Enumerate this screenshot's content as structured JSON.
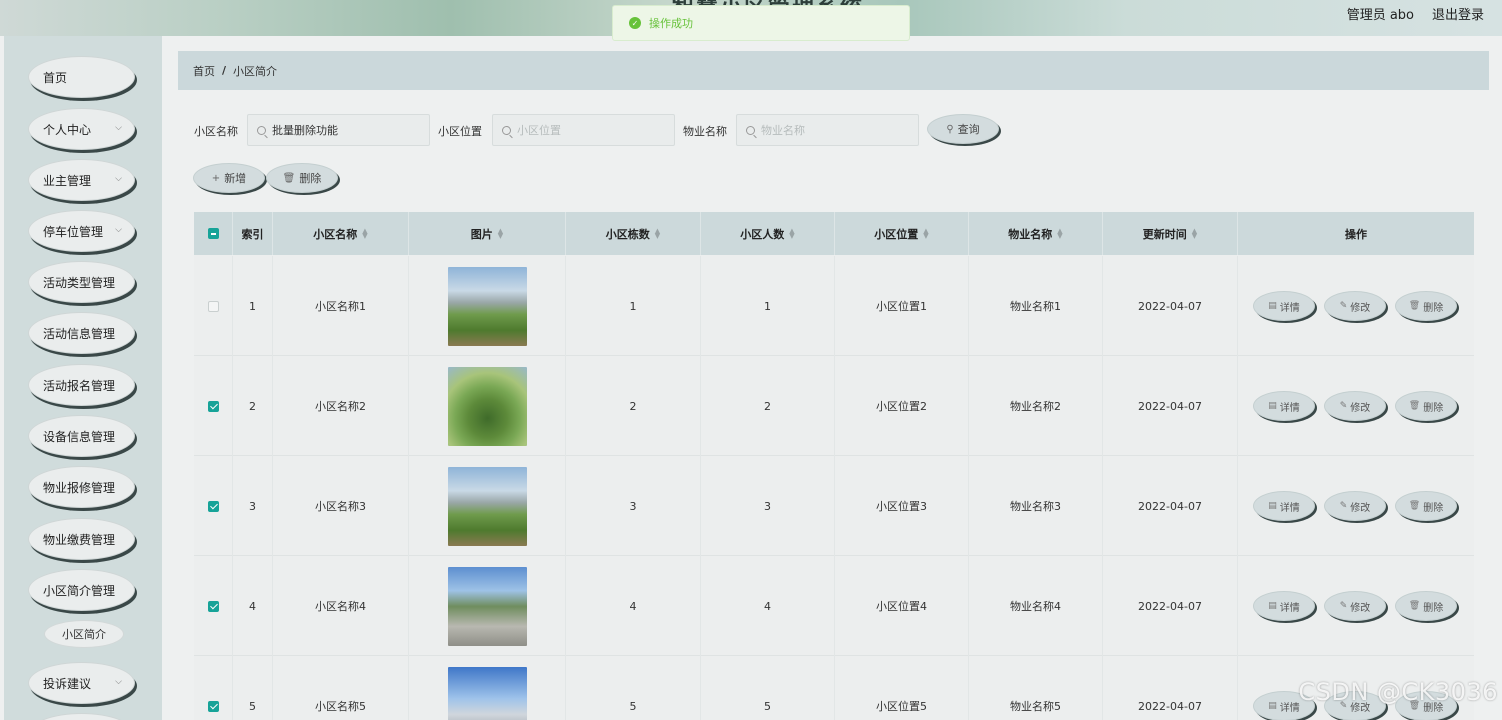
{
  "header": {
    "site_title": "智慧小区管理系统",
    "admin_label": "管理员 abo",
    "logout_label": "退出登录"
  },
  "toast": {
    "message": "操作成功"
  },
  "sidebar": {
    "items": [
      {
        "label": "首页",
        "has_chevron": false
      },
      {
        "label": "个人中心",
        "has_chevron": true
      },
      {
        "label": "业主管理",
        "has_chevron": true
      },
      {
        "label": "停车位管理",
        "has_chevron": true
      },
      {
        "label": "活动类型管理",
        "has_chevron": false
      },
      {
        "label": "活动信息管理",
        "has_chevron": false
      },
      {
        "label": "活动报名管理",
        "has_chevron": false
      },
      {
        "label": "设备信息管理",
        "has_chevron": false
      },
      {
        "label": "物业报修管理",
        "has_chevron": false
      },
      {
        "label": "物业缴费管理",
        "has_chevron": false
      },
      {
        "label": "小区简介管理",
        "has_chevron": false
      },
      {
        "label": "投诉建议",
        "has_chevron": true
      }
    ],
    "subitem": "小区简介"
  },
  "breadcrumb": {
    "home": "首页",
    "separator": "/",
    "current": "小区简介"
  },
  "search": {
    "name_label": "小区名称",
    "name_value": "批量删除功能",
    "name_placeholder": "小区名称",
    "location_label": "小区位置",
    "location_placeholder": "小区位置",
    "property_label": "物业名称",
    "property_placeholder": "物业名称",
    "query_label": "查询"
  },
  "toolbar": {
    "add_label": "新增",
    "delete_label": "删除"
  },
  "table": {
    "columns": [
      "索引",
      "小区名称",
      "图片",
      "小区栋数",
      "小区人数",
      "小区位置",
      "物业名称",
      "更新时间",
      "操作"
    ],
    "rows": [
      {
        "index": "1",
        "name": "小区名称1",
        "buildings": "1",
        "people": "1",
        "location": "小区位置1",
        "property": "物业名称1",
        "updated": "2022-04-07",
        "checked": false
      },
      {
        "index": "2",
        "name": "小区名称2",
        "buildings": "2",
        "people": "2",
        "location": "小区位置2",
        "property": "物业名称2",
        "updated": "2022-04-07",
        "checked": true
      },
      {
        "index": "3",
        "name": "小区名称3",
        "buildings": "3",
        "people": "3",
        "location": "小区位置3",
        "property": "物业名称3",
        "updated": "2022-04-07",
        "checked": true
      },
      {
        "index": "4",
        "name": "小区名称4",
        "buildings": "4",
        "people": "4",
        "location": "小区位置4",
        "property": "物业名称4",
        "updated": "2022-04-07",
        "checked": true
      },
      {
        "index": "5",
        "name": "小区名称5",
        "buildings": "5",
        "people": "5",
        "location": "小区位置5",
        "property": "物业名称5",
        "updated": "2022-04-07",
        "checked": true
      }
    ],
    "actions": {
      "detail": "详情",
      "edit": "修改",
      "delete": "删除"
    }
  },
  "watermark": "CSDN @CK3036",
  "colors": {
    "accent": "#17a398",
    "success": "#67c23a",
    "sidebar_bg": "#d0dcdc",
    "header_row_bg": "#ccd9db"
  }
}
